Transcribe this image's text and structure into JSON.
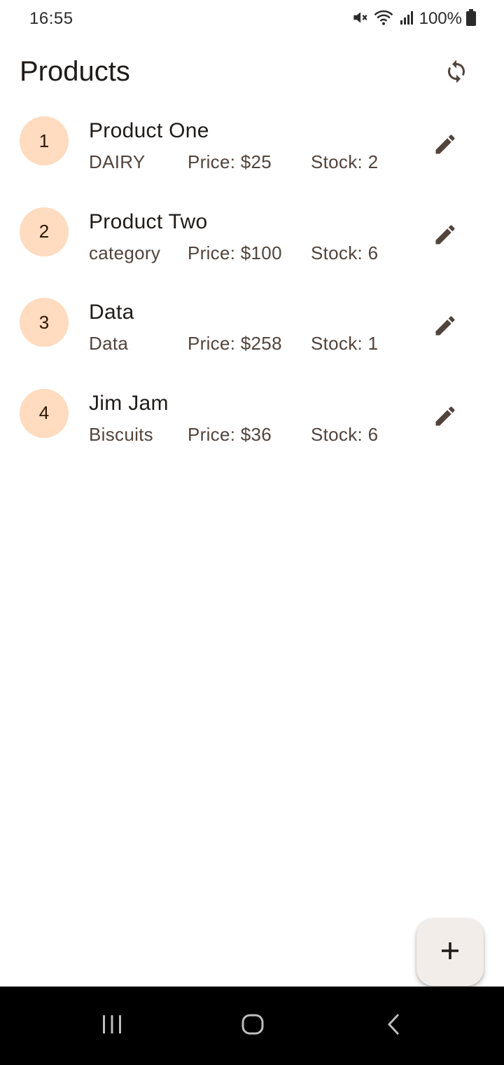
{
  "status_bar": {
    "time": "16:55",
    "battery": "100%",
    "icons": [
      "mute-icon",
      "wifi-icon",
      "signal-icon",
      "battery-icon"
    ]
  },
  "app_bar": {
    "title": "Products",
    "refresh_icon": "refresh-icon"
  },
  "products": [
    {
      "index": "1",
      "name": "Product One",
      "category": "DAIRY",
      "price": "Price: $25",
      "stock": "Stock: 2"
    },
    {
      "index": "2",
      "name": "Product Two",
      "category": "category",
      "price": "Price: $100",
      "stock": "Stock: 6"
    },
    {
      "index": "3",
      "name": "Data",
      "category": "Data",
      "price": "Price: $258",
      "stock": "Stock: 1"
    },
    {
      "index": "4",
      "name": "Jim Jam",
      "category": "Biscuits",
      "price": "Price: $36",
      "stock": "Stock: 6"
    }
  ],
  "fab": {
    "icon": "add-icon"
  },
  "nav_bar": {
    "icons": [
      "recent-apps-icon",
      "home-icon",
      "back-icon"
    ]
  },
  "colors": {
    "avatar_bg": "#ffdbc0",
    "avatar_text": "#2d1600",
    "secondary_text": "#52443c",
    "icon": "#52443c",
    "fab_bg": "#f3ede9"
  }
}
